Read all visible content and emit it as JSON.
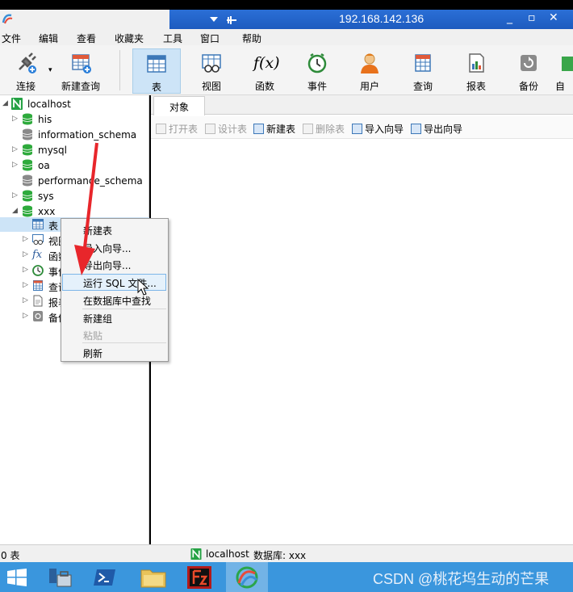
{
  "remote": {
    "ip": "192.168.142.136",
    "pin_glyph": "▾  ╤",
    "controls": [
      "_",
      "▫",
      "✕"
    ]
  },
  "menu": [
    "文件",
    "编辑",
    "查看",
    "收藏夹",
    "工具",
    "窗口",
    "帮助"
  ],
  "toolbar": [
    {
      "label": "连接",
      "icon": "connection-plug-icon"
    },
    {
      "label": "新建查询",
      "icon": "new-query-icon"
    },
    {
      "label": "表",
      "icon": "table-icon",
      "active": true
    },
    {
      "label": "视图",
      "icon": "view-icon"
    },
    {
      "label": "函数",
      "icon": "function-icon",
      "glyph": "f(x)"
    },
    {
      "label": "事件",
      "icon": "event-clock-icon"
    },
    {
      "label": "用户",
      "icon": "user-icon"
    },
    {
      "label": "查询",
      "icon": "query-icon"
    },
    {
      "label": "报表",
      "icon": "report-icon"
    },
    {
      "label": "备份",
      "icon": "backup-icon"
    },
    {
      "label": "自",
      "icon": "automation-icon"
    }
  ],
  "tree": {
    "connection": "localhost",
    "databases": [
      "his",
      "information_schema",
      "mysql",
      "oa",
      "performance_schema",
      "sys",
      "xxx"
    ],
    "xxx_children": [
      "表",
      "视图",
      "函数",
      "事件",
      "查询",
      "报表",
      "备份"
    ],
    "xxx_fx_glyph": "fx"
  },
  "tabs": {
    "objects": "对象"
  },
  "object_toolbar": [
    "打开表",
    "设计表",
    "新建表",
    "删除表",
    "导入向导",
    "导出向导"
  ],
  "context_menu": [
    "新建表",
    "导入向导...",
    "导出向导...",
    "运行 SQL 文件...",
    "在数据库中查找",
    "新建组",
    "粘贴",
    "刷新"
  ],
  "status": {
    "count": "0 表",
    "connection": "localhost",
    "database": "数据库: xxx"
  },
  "watermark": "CSDN @桃花坞生动的芒果",
  "colors": {
    "accent": "#2b6fd6",
    "taskbar": "#3a96dd",
    "selection": "#cde4f7",
    "arrow": "#e8262b",
    "db_green": "#2eaa3c"
  }
}
